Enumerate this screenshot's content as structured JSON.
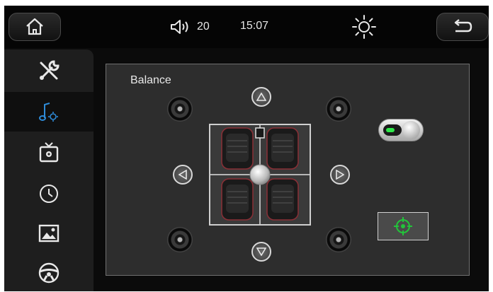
{
  "topbar": {
    "home_icon": "home-icon",
    "volume_icon": "speaker-volume-icon",
    "volume_value": "20",
    "time": "15:07",
    "brightness_icon": "sun-brightness-icon",
    "back_icon": "return-arrow-icon"
  },
  "sidebar": {
    "items": [
      {
        "icon": "tools-icon",
        "active": false
      },
      {
        "icon": "music-settings-icon",
        "active": true
      },
      {
        "icon": "tv-settings-icon",
        "active": false
      },
      {
        "icon": "clock-icon",
        "active": false
      },
      {
        "icon": "picture-icon",
        "active": false
      },
      {
        "icon": "steering-wheel-icon",
        "active": false
      }
    ]
  },
  "balance": {
    "title": "Balance",
    "toggle_on": true,
    "controls": {
      "up_icon": "arrow-up-icon",
      "down_icon": "arrow-down-icon",
      "left_icon": "arrow-left-icon",
      "right_icon": "arrow-right-icon",
      "center_icon": "target-center-icon"
    }
  },
  "colors": {
    "accent_blue": "#2e8bd8",
    "toggle_green": "#2fe84a",
    "target_green": "#22c43a"
  }
}
